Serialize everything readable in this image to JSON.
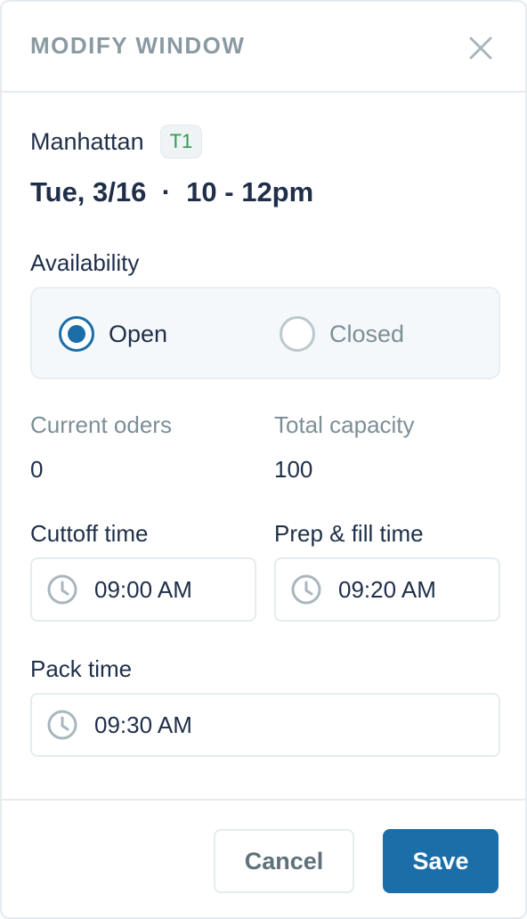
{
  "header": {
    "title": "MODIFY WINDOW",
    "close_icon": "close-icon"
  },
  "window": {
    "location": "Manhattan",
    "badge": "T1",
    "date": "Tue, 3/16",
    "separator": "·",
    "time_range": "10 - 12pm"
  },
  "availability": {
    "label": "Availability",
    "options": [
      {
        "label": "Open",
        "checked": true
      },
      {
        "label": "Closed",
        "checked": false
      }
    ]
  },
  "stats": {
    "current_orders_label": "Current oders",
    "current_orders_value": "0",
    "total_capacity_label": "Total capacity",
    "total_capacity_value": "100"
  },
  "times": {
    "cutoff_label": "Cuttoff time",
    "cutoff_value": "09:00 AM",
    "prep_label": "Prep & fill time",
    "prep_value": "09:20 AM",
    "pack_label": "Pack time",
    "pack_value": "09:30 AM",
    "icon": "clock-icon"
  },
  "footer": {
    "cancel_label": "Cancel",
    "save_label": "Save"
  },
  "colors": {
    "accent": "#1b6ea8",
    "badge_text": "#2f9b50",
    "text_primary": "#1f2f49",
    "text_muted": "#7d8e97",
    "border": "#e6ebee"
  }
}
